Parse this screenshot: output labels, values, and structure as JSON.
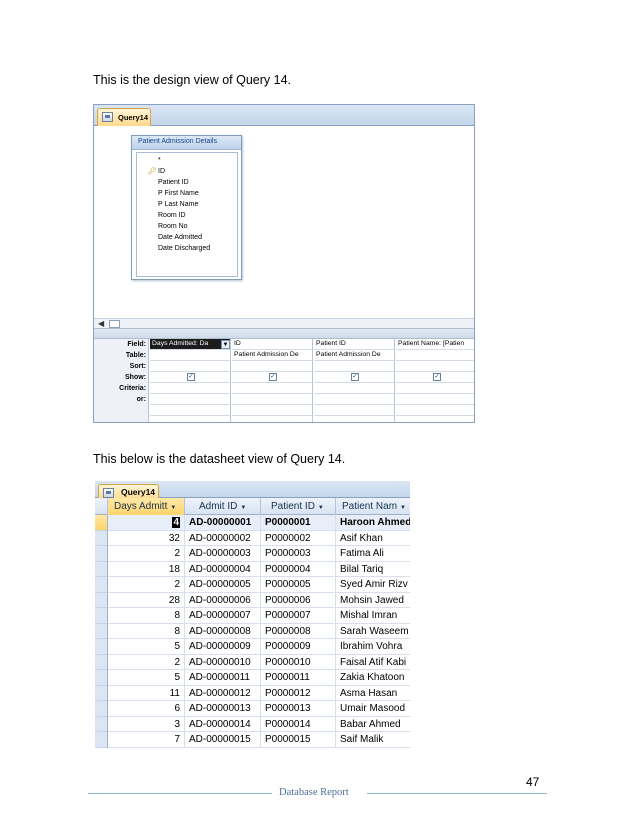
{
  "captions": {
    "design": "This is the design view of Query 14.",
    "datasheet": "This below is the datasheet view of Query 14."
  },
  "design_view": {
    "tab_label": "Query14",
    "table_box": {
      "title": "Patient Admission Details",
      "fields": [
        "*",
        "ID",
        "Patient ID",
        "P First Name",
        "P Last Name",
        "Room ID",
        "Room No",
        "Date Admitted",
        "Date Discharged"
      ]
    },
    "grid": {
      "row_labels": [
        "Field:",
        "Table:",
        "Sort:",
        "Show:",
        "Criteria:",
        "or:"
      ],
      "columns": [
        {
          "field": "Days Admitted: Da",
          "table": "",
          "show": true
        },
        {
          "field": "ID",
          "table": "Patient Admission De",
          "show": true
        },
        {
          "field": "Patient ID",
          "table": "Patient Admission De",
          "show": true
        },
        {
          "field": "Patient Name: [Patien",
          "table": "",
          "show": true
        }
      ]
    }
  },
  "datasheet_view": {
    "tab_label": "Query14",
    "headers": [
      "Days Admitt",
      "Admit ID",
      "Patient ID",
      "Patient Nam"
    ],
    "rows": [
      [
        "4",
        "AD-00000001",
        "P0000001",
        "Haroon Ahmed"
      ],
      [
        "32",
        "AD-00000002",
        "P0000002",
        "Asif Khan"
      ],
      [
        "2",
        "AD-00000003",
        "P0000003",
        "Fatima Ali"
      ],
      [
        "18",
        "AD-00000004",
        "P0000004",
        "Bilal Tariq"
      ],
      [
        "2",
        "AD-00000005",
        "P0000005",
        "Syed Amir Rizv"
      ],
      [
        "28",
        "AD-00000006",
        "P0000006",
        "Mohsin Jawed"
      ],
      [
        "8",
        "AD-00000007",
        "P0000007",
        "Mishal Imran"
      ],
      [
        "8",
        "AD-00000008",
        "P0000008",
        "Sarah Waseem"
      ],
      [
        "5",
        "AD-00000009",
        "P0000009",
        "Ibrahim Vohra"
      ],
      [
        "2",
        "AD-00000010",
        "P0000010",
        "Faisal Atif Kabi"
      ],
      [
        "5",
        "AD-00000011",
        "P0000011",
        "Zakia Khatoon"
      ],
      [
        "11",
        "AD-00000012",
        "P0000012",
        "Asma Hasan"
      ],
      [
        "6",
        "AD-00000013",
        "P0000013",
        "Umair Masood"
      ],
      [
        "3",
        "AD-00000014",
        "P0000014",
        "Babar Ahmed"
      ],
      [
        "7",
        "AD-00000015",
        "P0000015",
        "Saif Malik"
      ]
    ]
  },
  "footer": {
    "page_number": "47",
    "text": "Database Report"
  },
  "colors": {
    "accent_line": "#8fb4d6",
    "footer_text": "#4f6f95"
  }
}
